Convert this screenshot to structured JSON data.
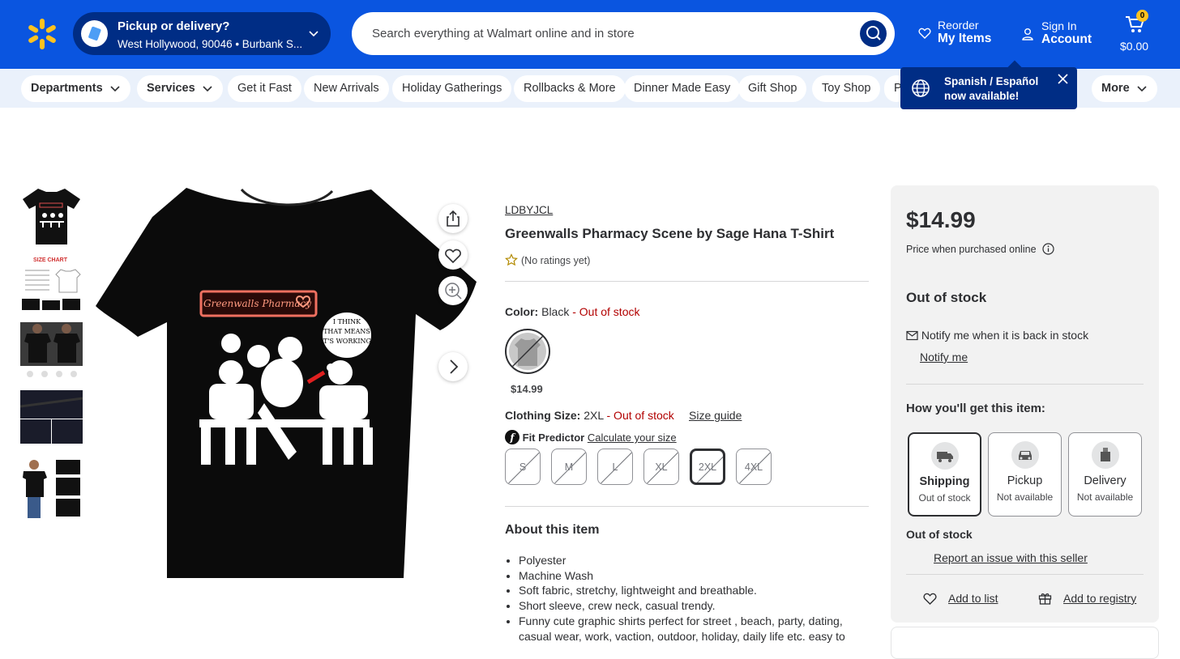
{
  "header": {
    "pickup_title": "Pickup or delivery?",
    "pickup_location": "West Hollywood, 90046 • Burbank S...",
    "search_placeholder": "Search everything at Walmart online and in store",
    "reorder_top": "Reorder",
    "reorder_bottom": "My Items",
    "signin_top": "Sign In",
    "signin_bottom": "Account",
    "cart_count": "0",
    "cart_total": "$0.00"
  },
  "nav": {
    "departments": "Departments",
    "services": "Services",
    "items": [
      "Get it Fast",
      "New Arrivals",
      "Holiday Gatherings",
      "Rollbacks & More",
      "Dinner Made Easy",
      "Gift Shop",
      "Toy Shop",
      "P"
    ],
    "more": "More"
  },
  "tooltip": {
    "line1": "Spanish / Español",
    "line2": "now available!"
  },
  "product": {
    "brand": "LDBYJCL",
    "title": "Greenwalls Pharmacy Scene by Sage Hana T-Shirt",
    "rating": "(No ratings yet)",
    "color_label": "Color:",
    "color_value": "Black",
    "color_status": "- Out of stock",
    "swatch_price": "$14.99",
    "size_label": "Clothing Size:",
    "size_value": "2XL",
    "size_status": "- Out of stock",
    "size_guide": "Size guide",
    "fit_label": "Fit Predictor",
    "fit_link": "Calculate your size",
    "sizes": [
      "S",
      "M",
      "L",
      "XL",
      "2XL",
      "4XL"
    ],
    "selected_size": "2XL",
    "shirt_sign": "Greenwalls Pharmacy",
    "shirt_bubble": "I THINK THAT MEANS IT'S WORKING."
  },
  "thumb_size_chart": "SIZE CHART",
  "about": {
    "heading": "About this item",
    "bullets": [
      "Polyester",
      "Machine Wash",
      "Soft fabric, stretchy, lightweight and breathable.",
      "Short sleeve, crew neck, casual trendy.",
      "Funny cute graphic shirts perfect for street , beach, party, dating, casual wear, work, vaction, outdoor, holiday, daily life etc. easy to"
    ]
  },
  "buybox": {
    "price": "$14.99",
    "price_note": "Price when purchased online",
    "stock": "Out of stock",
    "notify_text": "Notify me when it is back in stock",
    "notify_link": "Notify me",
    "how_heading": "How you'll get this item:",
    "options": [
      {
        "name": "Shipping",
        "status": "Out of stock"
      },
      {
        "name": "Pickup",
        "status": "Not available"
      },
      {
        "name": "Delivery",
        "status": "Not available"
      }
    ],
    "stock2": "Out of stock",
    "report": "Report an issue with this seller",
    "add_list": "Add to list",
    "add_registry": "Add to registry"
  },
  "colors": {
    "brand_blue": "#0a55e0",
    "dark_blue": "#002d85",
    "spark": "#ffc220",
    "error_red": "#b20000"
  }
}
